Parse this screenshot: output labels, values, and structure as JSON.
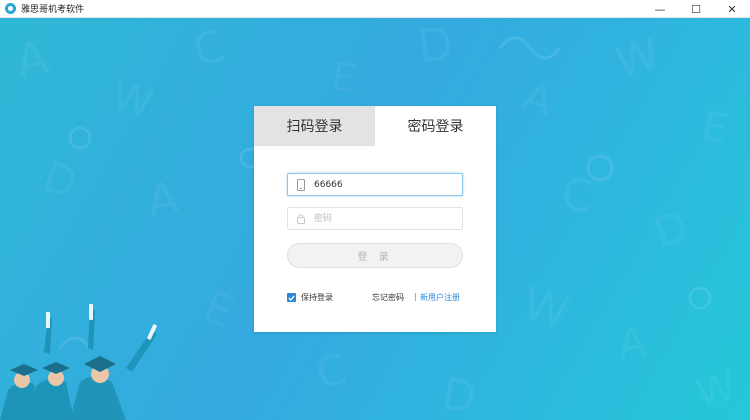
{
  "window": {
    "title": "雅思哥机考软件",
    "minimize_glyph": "—",
    "maximize_glyph": "☐",
    "close_glyph": "✕"
  },
  "login": {
    "tabs": [
      {
        "label": "扫码登录",
        "active": false
      },
      {
        "label": "密码登录",
        "active": true
      }
    ],
    "phone_value": "66666",
    "password_placeholder": "密码",
    "login_button": "登 录",
    "remember_label": "保持登录",
    "remember_checked": true,
    "forgot_label": "忘记密码",
    "separator": "|",
    "register_label": "新用户注册"
  },
  "colors": {
    "accent": "#2f86d4",
    "background_gradient": [
      "#2fb8d6",
      "#34a9e0",
      "#25c8d8"
    ]
  }
}
